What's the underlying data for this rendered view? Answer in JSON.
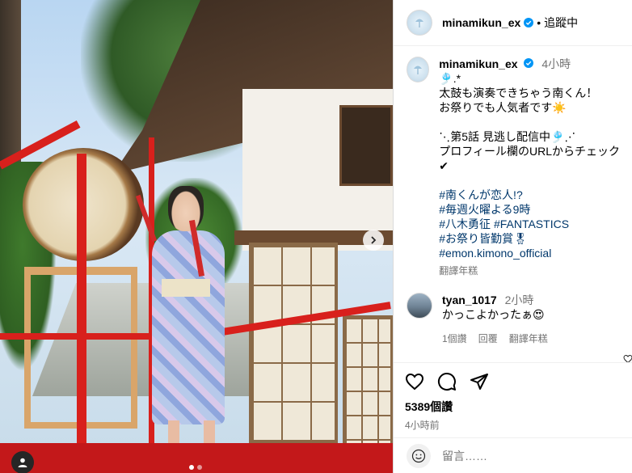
{
  "post": {
    "author": "minamikun_ex",
    "follow_status": "追蹤中",
    "separator": "•"
  },
  "caption": {
    "author": "minamikun_ex",
    "time": "4小時",
    "lines": [
      "🎐.*",
      "太鼓も演奏できちゃう南くん！",
      "お祭りでも人気者です☀️",
      "",
      "⋱第5話 見逃し配信中🎐⋰",
      "プロフィール欄のURLからチェック",
      "✔"
    ],
    "hashtags": [
      "#南くんが恋人!?",
      "#毎週火曜よる9時",
      "#八木勇征 #FANTASTICS",
      "#お祭り皆勤賞🎖",
      "#emon.kimono_official"
    ],
    "translate": "翻譯年糕"
  },
  "comment": {
    "author": "tyan_1017",
    "time": "2小時",
    "text": "かっこよかったぁ😍",
    "likes": "1個讚",
    "reply": "回覆",
    "translate": "翻譯年糕"
  },
  "actions": {
    "likes": "5389個讚",
    "posted": "4小時前"
  },
  "input": {
    "placeholder": "留言……"
  },
  "carousel": {
    "slides": 2,
    "active_index": 0
  },
  "icons": [
    "verified-badge-icon",
    "chevron-right-icon",
    "user-tag-icon",
    "heart-icon",
    "comment-icon",
    "share-icon",
    "smiley-icon"
  ],
  "colors": {
    "link": "#00376b",
    "verified": "#0095f6",
    "muted": "#737373",
    "rail": "#d8201c"
  }
}
